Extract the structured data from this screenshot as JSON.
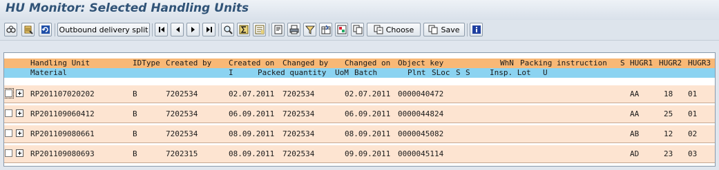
{
  "window": {
    "title": "HU Monitor: Selected Handling Units"
  },
  "toolbar": {
    "buttons": [
      {
        "name": "find-icon",
        "label": ""
      },
      {
        "name": "details-icon",
        "label": ""
      },
      {
        "name": "refresh-icon",
        "label": ""
      },
      {
        "name": "outbound-delivery-split-button",
        "label": "Outbound delivery split"
      },
      {
        "name": "first-page-icon",
        "label": ""
      },
      {
        "name": "previous-page-icon",
        "label": ""
      },
      {
        "name": "next-page-icon",
        "label": ""
      },
      {
        "name": "last-page-icon",
        "label": ""
      },
      {
        "name": "search-icon",
        "label": ""
      },
      {
        "name": "sum-icon",
        "label": ""
      },
      {
        "name": "subtotal-icon",
        "label": ""
      },
      {
        "name": "print-preview-icon",
        "label": ""
      },
      {
        "name": "print-icon",
        "label": ""
      },
      {
        "name": "filter-icon",
        "label": ""
      },
      {
        "name": "export-icon",
        "label": ""
      },
      {
        "name": "layout-icon",
        "label": ""
      },
      {
        "name": "copy-icon",
        "label": ""
      },
      {
        "name": "choose-button",
        "label": "Choose"
      },
      {
        "name": "save-button",
        "label": "Save"
      },
      {
        "name": "info-icon",
        "label": ""
      }
    ]
  },
  "grid": {
    "header_row1": {
      "handling_unit": "Handling Unit",
      "idtype": "IDType",
      "created_by": "Created by",
      "created_on": "Created on",
      "changed_by": "Changed by",
      "changed_on": "Changed on",
      "object_key": "Object key",
      "whn": "WhN",
      "packing_instruction": "Packing instruction",
      "s": "S",
      "hugr1": "HUGR1",
      "hugr2": "HUGR2",
      "hugr3": "HUGR3"
    },
    "header_row2": {
      "material": "Material",
      "i": "I",
      "packed_quantity": "Packed quantity",
      "uom": "UoM",
      "batch": "Batch",
      "plnt": "Plnt",
      "sloc": "SLoc",
      "s1": "S",
      "s2": "S",
      "insp_lot": "Insp. Lot",
      "u": "U"
    },
    "rows": [
      {
        "hu": "RP201107020202",
        "idtype": "B",
        "created_by": "7202534",
        "created_on": "02.07.2011",
        "changed_by": "7202534",
        "changed_on": "02.07.2011",
        "object_key": "0000040472",
        "hugr1": "AA",
        "hugr2": "18",
        "hugr3": "01"
      },
      {
        "hu": "RP201109060412",
        "idtype": "B",
        "created_by": "7202534",
        "created_on": "06.09.2011",
        "changed_by": "7202534",
        "changed_on": "06.09.2011",
        "object_key": "0000044824",
        "hugr1": "AA",
        "hugr2": "25",
        "hugr3": "01"
      },
      {
        "hu": "RP201109080661",
        "idtype": "B",
        "created_by": "7202534",
        "created_on": "08.09.2011",
        "changed_by": "7202534",
        "changed_on": "08.09.2011",
        "object_key": "0000045082",
        "hugr1": "AB",
        "hugr2": "12",
        "hugr3": "02"
      },
      {
        "hu": "RP201109080693",
        "idtype": "B",
        "created_by": "7202315",
        "created_on": "08.09.2011",
        "changed_by": "7202534",
        "changed_on": "09.09.2011",
        "object_key": "0000045114",
        "hugr1": "AD",
        "hugr2": "23",
        "hugr3": "03"
      }
    ]
  },
  "colors": {
    "header1": "#f8b876",
    "header2": "#8bd3f1",
    "row": "#fde4d1",
    "title": "#305377"
  }
}
